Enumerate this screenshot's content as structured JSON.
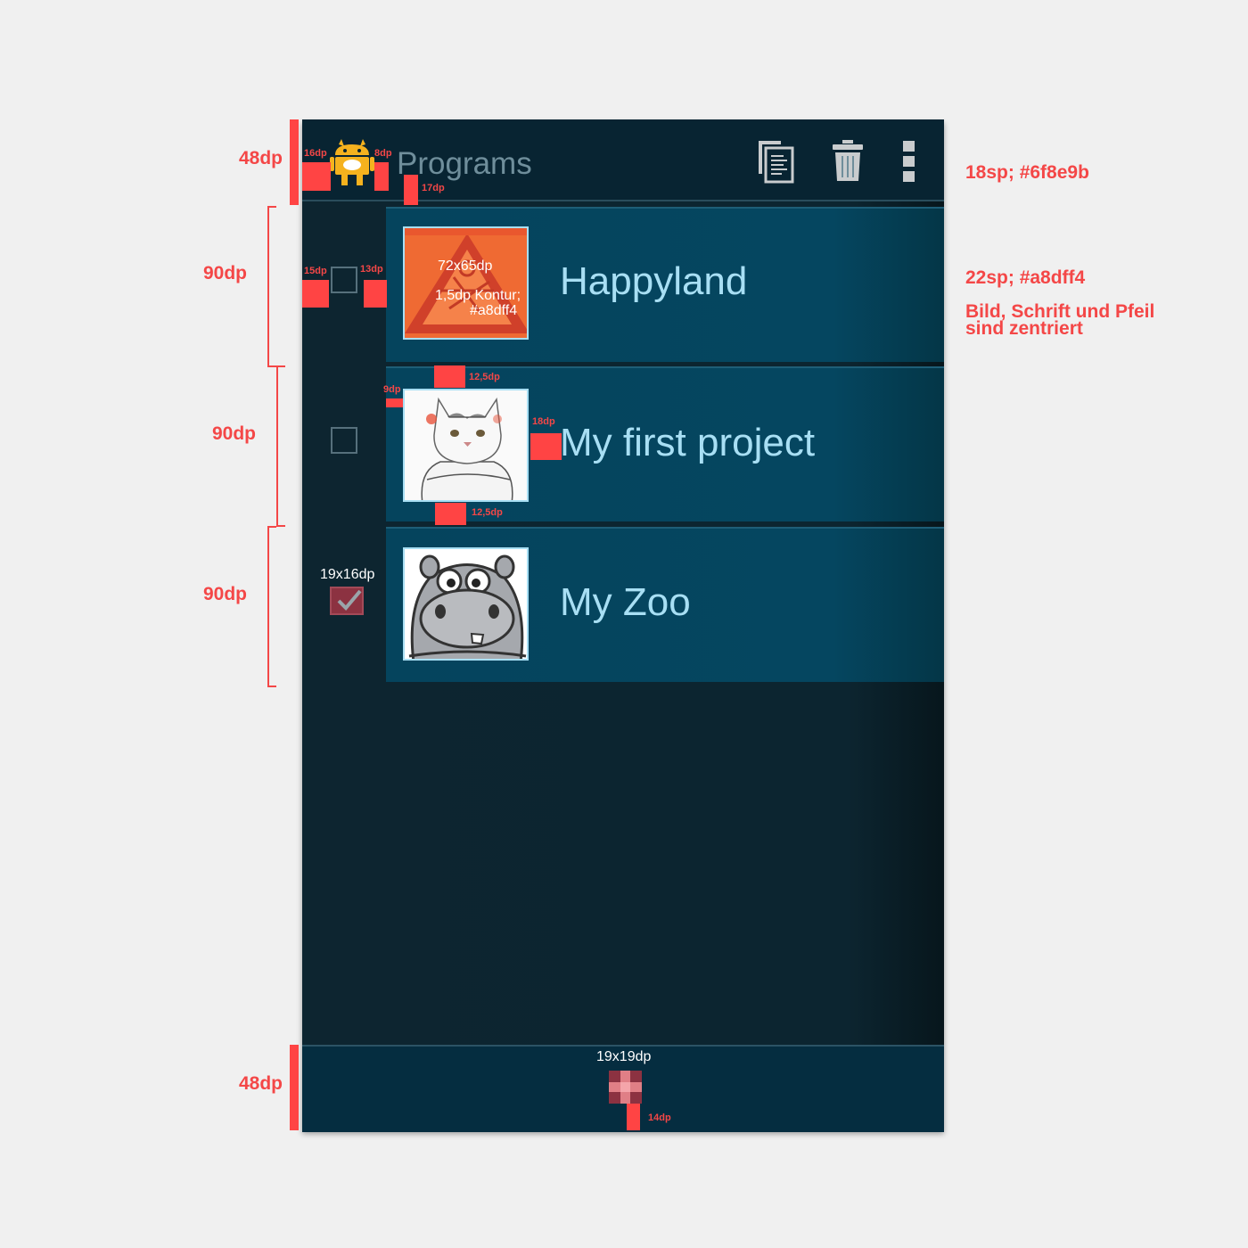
{
  "action_bar": {
    "title": "Programs",
    "icons": [
      "android-app-icon",
      "copy-icon",
      "trash-icon",
      "overflow-menu-icon"
    ]
  },
  "programs": [
    {
      "name": "Happyland",
      "thumbnail": "orange-sign-image",
      "checked": false
    },
    {
      "name": "My first project",
      "thumbnail": "cat-image",
      "checked": false
    },
    {
      "name": "My Zoo",
      "thumbnail": "hippo-image",
      "checked": true
    }
  ],
  "bottom_bar": {
    "icon": "plus-icon"
  },
  "specs": {
    "actionbar_height": "48dp",
    "row_height": "90dp",
    "bottombar_height": "48dp",
    "title_style": "18sp; #6f8e9b",
    "label_style": "22sp; #a8dff4",
    "centered_note_1": "Bild, Schrift und Pfeil",
    "centered_note_2": "sind zentriert",
    "icon_left": "16dp",
    "icon_right": "8dp",
    "title_bottom": "17dp",
    "checkbox_left": "15dp",
    "checkbox_right": "13dp",
    "thumb_size": "72x65dp",
    "thumb_border_1": "1,5dp Kontur;",
    "thumb_border_2": "#a8dff4",
    "thumb_top": "12,5dp",
    "thumb_bottom": "12,5dp",
    "thumb_left": "9dp",
    "thumb_right": "18dp",
    "checkbox_size": "19x16dp",
    "plus_size": "19x19dp",
    "plus_bottom": "14dp"
  },
  "colors": {
    "title": "#6f8e9b",
    "label": "#a8dff4",
    "spec_red": "#f44747"
  }
}
